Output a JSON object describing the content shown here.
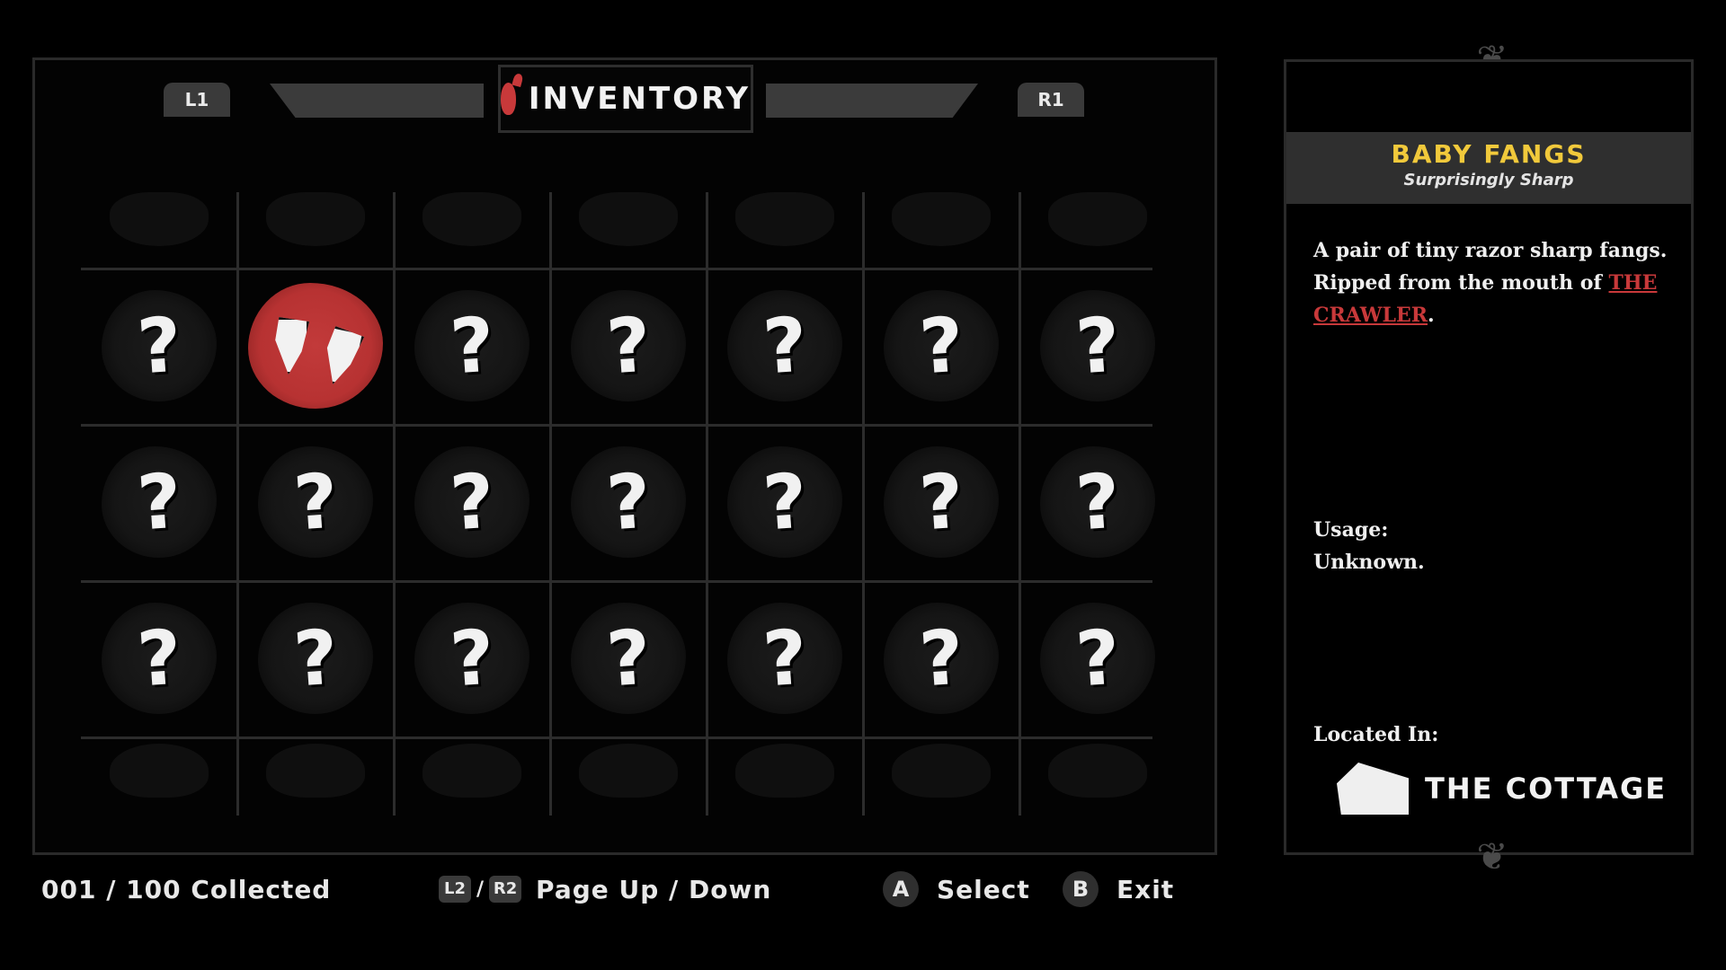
{
  "header": {
    "title": "INVENTORY",
    "title_icon": "blood-drop-icon",
    "left_shoulder": "L1",
    "right_shoulder": "R1"
  },
  "grid": {
    "columns": 7,
    "rows": 3,
    "unknown_symbol": "?",
    "selected_index": 1,
    "selected_icon": "fangs-icon"
  },
  "detail": {
    "item_name": "BABY FANGS",
    "item_subtitle": "Surprisingly Sharp",
    "description_1": "A pair of tiny razor sharp fangs. Ripped from the mouth of ",
    "description_link": "THE CRAWLER",
    "description_end": ".",
    "usage_label": "Usage:",
    "usage_value": "Unknown.",
    "located_label": "Located In:",
    "location_name": "THE COTTAGE",
    "location_icon": "cottage-icon"
  },
  "footer": {
    "collected": "001 / 100 Collected",
    "page_buttons": [
      "L2",
      "R2"
    ],
    "page_label": "Page Up / Down",
    "select_button": "A",
    "select_label": "Select",
    "exit_button": "B",
    "exit_label": "Exit"
  },
  "colors": {
    "accent_red": "#c8393a",
    "title_gold": "#f1c93b",
    "background": "#000000"
  }
}
